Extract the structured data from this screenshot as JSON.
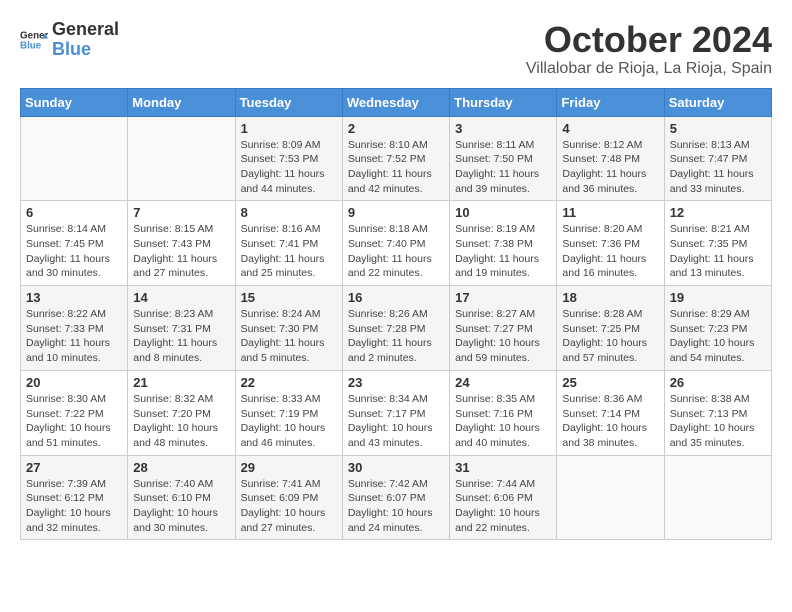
{
  "header": {
    "logo_line1": "General",
    "logo_line2": "Blue",
    "month_year": "October 2024",
    "location": "Villalobar de Rioja, La Rioja, Spain"
  },
  "days_of_week": [
    "Sunday",
    "Monday",
    "Tuesday",
    "Wednesday",
    "Thursday",
    "Friday",
    "Saturday"
  ],
  "weeks": [
    [
      {
        "day": "",
        "info": ""
      },
      {
        "day": "",
        "info": ""
      },
      {
        "day": "1",
        "info": "Sunrise: 8:09 AM\nSunset: 7:53 PM\nDaylight: 11 hours and 44 minutes."
      },
      {
        "day": "2",
        "info": "Sunrise: 8:10 AM\nSunset: 7:52 PM\nDaylight: 11 hours and 42 minutes."
      },
      {
        "day": "3",
        "info": "Sunrise: 8:11 AM\nSunset: 7:50 PM\nDaylight: 11 hours and 39 minutes."
      },
      {
        "day": "4",
        "info": "Sunrise: 8:12 AM\nSunset: 7:48 PM\nDaylight: 11 hours and 36 minutes."
      },
      {
        "day": "5",
        "info": "Sunrise: 8:13 AM\nSunset: 7:47 PM\nDaylight: 11 hours and 33 minutes."
      }
    ],
    [
      {
        "day": "6",
        "info": "Sunrise: 8:14 AM\nSunset: 7:45 PM\nDaylight: 11 hours and 30 minutes."
      },
      {
        "day": "7",
        "info": "Sunrise: 8:15 AM\nSunset: 7:43 PM\nDaylight: 11 hours and 27 minutes."
      },
      {
        "day": "8",
        "info": "Sunrise: 8:16 AM\nSunset: 7:41 PM\nDaylight: 11 hours and 25 minutes."
      },
      {
        "day": "9",
        "info": "Sunrise: 8:18 AM\nSunset: 7:40 PM\nDaylight: 11 hours and 22 minutes."
      },
      {
        "day": "10",
        "info": "Sunrise: 8:19 AM\nSunset: 7:38 PM\nDaylight: 11 hours and 19 minutes."
      },
      {
        "day": "11",
        "info": "Sunrise: 8:20 AM\nSunset: 7:36 PM\nDaylight: 11 hours and 16 minutes."
      },
      {
        "day": "12",
        "info": "Sunrise: 8:21 AM\nSunset: 7:35 PM\nDaylight: 11 hours and 13 minutes."
      }
    ],
    [
      {
        "day": "13",
        "info": "Sunrise: 8:22 AM\nSunset: 7:33 PM\nDaylight: 11 hours and 10 minutes."
      },
      {
        "day": "14",
        "info": "Sunrise: 8:23 AM\nSunset: 7:31 PM\nDaylight: 11 hours and 8 minutes."
      },
      {
        "day": "15",
        "info": "Sunrise: 8:24 AM\nSunset: 7:30 PM\nDaylight: 11 hours and 5 minutes."
      },
      {
        "day": "16",
        "info": "Sunrise: 8:26 AM\nSunset: 7:28 PM\nDaylight: 11 hours and 2 minutes."
      },
      {
        "day": "17",
        "info": "Sunrise: 8:27 AM\nSunset: 7:27 PM\nDaylight: 10 hours and 59 minutes."
      },
      {
        "day": "18",
        "info": "Sunrise: 8:28 AM\nSunset: 7:25 PM\nDaylight: 10 hours and 57 minutes."
      },
      {
        "day": "19",
        "info": "Sunrise: 8:29 AM\nSunset: 7:23 PM\nDaylight: 10 hours and 54 minutes."
      }
    ],
    [
      {
        "day": "20",
        "info": "Sunrise: 8:30 AM\nSunset: 7:22 PM\nDaylight: 10 hours and 51 minutes."
      },
      {
        "day": "21",
        "info": "Sunrise: 8:32 AM\nSunset: 7:20 PM\nDaylight: 10 hours and 48 minutes."
      },
      {
        "day": "22",
        "info": "Sunrise: 8:33 AM\nSunset: 7:19 PM\nDaylight: 10 hours and 46 minutes."
      },
      {
        "day": "23",
        "info": "Sunrise: 8:34 AM\nSunset: 7:17 PM\nDaylight: 10 hours and 43 minutes."
      },
      {
        "day": "24",
        "info": "Sunrise: 8:35 AM\nSunset: 7:16 PM\nDaylight: 10 hours and 40 minutes."
      },
      {
        "day": "25",
        "info": "Sunrise: 8:36 AM\nSunset: 7:14 PM\nDaylight: 10 hours and 38 minutes."
      },
      {
        "day": "26",
        "info": "Sunrise: 8:38 AM\nSunset: 7:13 PM\nDaylight: 10 hours and 35 minutes."
      }
    ],
    [
      {
        "day": "27",
        "info": "Sunrise: 7:39 AM\nSunset: 6:12 PM\nDaylight: 10 hours and 32 minutes."
      },
      {
        "day": "28",
        "info": "Sunrise: 7:40 AM\nSunset: 6:10 PM\nDaylight: 10 hours and 30 minutes."
      },
      {
        "day": "29",
        "info": "Sunrise: 7:41 AM\nSunset: 6:09 PM\nDaylight: 10 hours and 27 minutes."
      },
      {
        "day": "30",
        "info": "Sunrise: 7:42 AM\nSunset: 6:07 PM\nDaylight: 10 hours and 24 minutes."
      },
      {
        "day": "31",
        "info": "Sunrise: 7:44 AM\nSunset: 6:06 PM\nDaylight: 10 hours and 22 minutes."
      },
      {
        "day": "",
        "info": ""
      },
      {
        "day": "",
        "info": ""
      }
    ]
  ]
}
